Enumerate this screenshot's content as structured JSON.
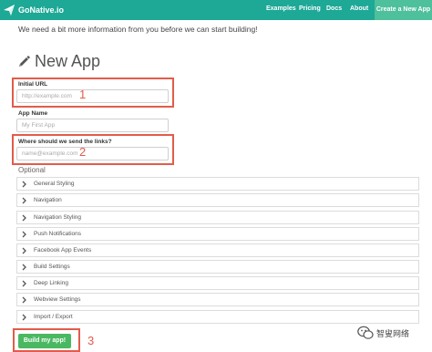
{
  "navbar": {
    "brand": "GoNative.io",
    "links": [
      "Examples",
      "Pricing",
      "Docs",
      "About"
    ],
    "cta": "Create a New App",
    "colors": {
      "background": "#1ea896",
      "cta_background": "#4ec09b"
    }
  },
  "intro_text": "We need a bit more information from you before we can start building!",
  "heading": {
    "icon": "pencil-icon",
    "title": "New App"
  },
  "fields": {
    "initial_url": {
      "label": "Initial URL",
      "placeholder": "http://example.com"
    },
    "app_name": {
      "label": "App Name",
      "placeholder": "My First App"
    },
    "email": {
      "label": "Where should we send the links?",
      "placeholder": "name@example.com"
    }
  },
  "annotations": [
    "1",
    "2",
    "3"
  ],
  "annotation_color": "#e25c4b",
  "optional": {
    "label": "Optional",
    "sections": [
      "General Styling",
      "Navigation",
      "Navigation Styling",
      "Push Notifications",
      "Facebook App Events",
      "Build Settings",
      "Deep Linking",
      "Webview Settings",
      "Import / Export"
    ]
  },
  "build_button": {
    "label": "Build my app!",
    "color": "#4ab860"
  },
  "watermark": {
    "icon": "wechat-icon",
    "text": "智叟网络"
  }
}
